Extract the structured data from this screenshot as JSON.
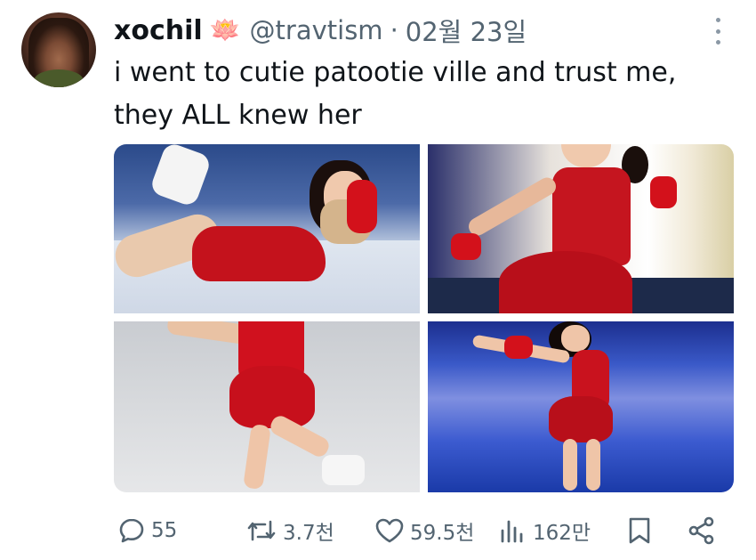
{
  "tweet": {
    "author_name": "xochil",
    "author_emoji": "🪷",
    "handle": "@travtism",
    "separator": "·",
    "date": "02월 23일",
    "text": "i went to cutie patootie ville and trust me, they ALL knew her"
  },
  "media": {
    "photo_count": 4
  },
  "actions": {
    "replies": "55",
    "retweets": "3.7천",
    "likes": "59.5천",
    "views": "162만"
  },
  "colors": {
    "text": "#0f1419",
    "secondary": "#536471",
    "icon": "#536471",
    "background": "#ffffff"
  },
  "icons": [
    "reply-icon",
    "retweet-icon",
    "like-icon",
    "views-icon",
    "bookmark-icon",
    "share-icon",
    "more-icon"
  ]
}
